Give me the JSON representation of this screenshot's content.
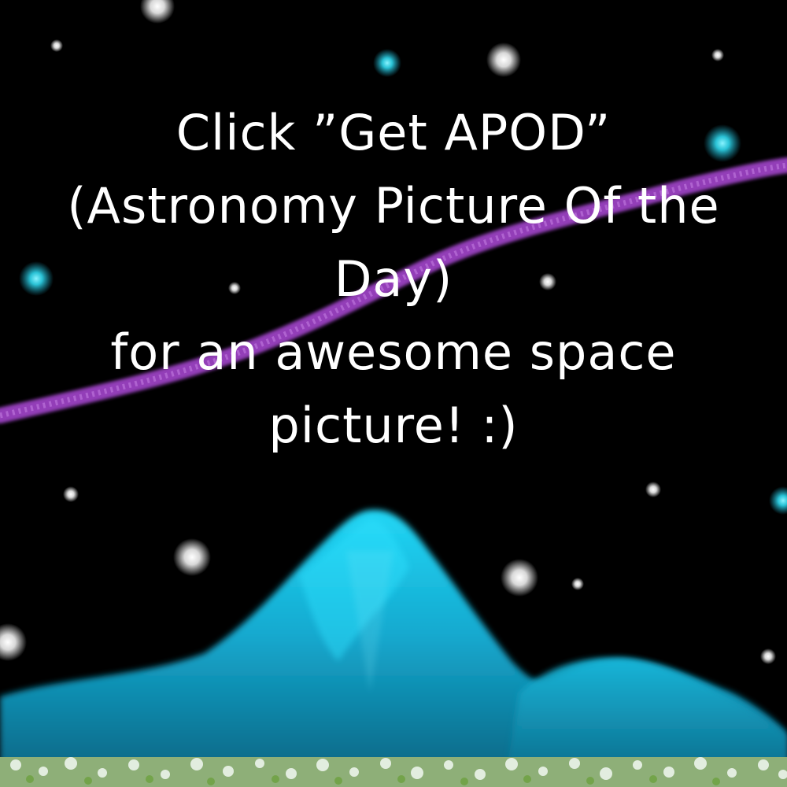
{
  "message": {
    "lines": [
      "Click ”Get APOD”",
      "(Astronomy Picture Of the",
      "Day)",
      "for an awesome space",
      "picture! :)"
    ]
  },
  "colors": {
    "sky": "#000000",
    "text": "#ffffff",
    "star_white": "#ffffff",
    "star_cyan": "#2fd8ee",
    "milky_way": "#a44fc6",
    "mountain_light": "#1fd0f2",
    "mountain_dark": "#0a5f7d",
    "grass": "#7fb04a",
    "snow": "#e8f4ee"
  },
  "icons": [
    "star-icon",
    "mountain-icon"
  ]
}
